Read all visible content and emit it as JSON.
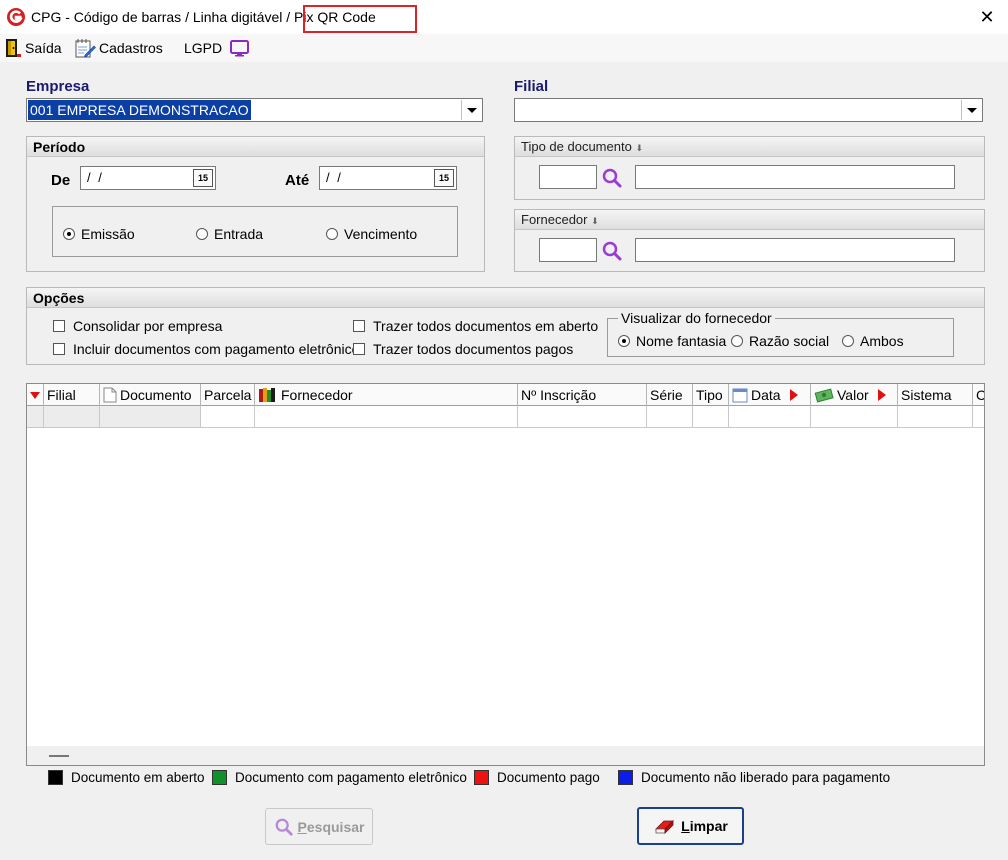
{
  "window": {
    "title_prefix": "CPG - Código de barras / Linha digitável /",
    "title_highlight": "Pix QR Code",
    "close_label": "✕"
  },
  "menu": {
    "items": [
      {
        "label": "Saída",
        "icon": "exit-door-icon"
      },
      {
        "label": "Cadastros",
        "icon": "notepad-icon"
      },
      {
        "label": "LGPD",
        "icon": "monitor-icon"
      }
    ]
  },
  "empresa": {
    "label": "Empresa",
    "value": "001 EMPRESA DEMONSTRACAO"
  },
  "filial": {
    "label": "Filial",
    "value": ""
  },
  "periodo": {
    "title": "Período",
    "de_label": "De",
    "de_value": "/ /",
    "ate_label": "Até",
    "ate_value": "/ /",
    "calendar_label": "15",
    "options": [
      {
        "label": "Emissão",
        "selected": true
      },
      {
        "label": "Entrada",
        "selected": false
      },
      {
        "label": "Vencimento",
        "selected": false
      }
    ]
  },
  "tipo_documento": {
    "label": "Tipo de documento",
    "code": "",
    "desc": ""
  },
  "fornecedor": {
    "label": "Fornecedor",
    "code": "",
    "desc": ""
  },
  "opcoes": {
    "title": "Opções",
    "checks": [
      {
        "label": "Consolidar por empresa",
        "checked": false
      },
      {
        "label": "Incluir documentos com pagamento eletrônico",
        "checked": false
      },
      {
        "label": "Trazer todos documentos em aberto",
        "checked": false
      },
      {
        "label": "Trazer todos documentos pagos",
        "checked": false
      }
    ],
    "visualizar": {
      "title": "Visualizar do fornecedor",
      "options": [
        {
          "label": "Nome fantasia",
          "selected": true
        },
        {
          "label": "Razão social",
          "selected": false
        },
        {
          "label": "Ambos",
          "selected": false
        }
      ]
    }
  },
  "grid": {
    "columns": [
      "Filial",
      "Documento",
      "Parcela",
      "Fornecedor",
      "Nº Inscrição",
      "Série",
      "Tipo",
      "Data",
      "Valor",
      "Sistema",
      "C"
    ]
  },
  "legend": [
    {
      "label": "Documento em aberto",
      "color": "#000000"
    },
    {
      "label": "Documento com pagamento eletrônico",
      "color": "#11912a"
    },
    {
      "label": "Documento pago",
      "color": "#ee1111"
    },
    {
      "label": "Documento não liberado para pagamento",
      "color": "#0a1ee8"
    }
  ],
  "buttons": {
    "pesquisar": {
      "mnemonic": "P",
      "rest": "esquisar"
    },
    "limpar": {
      "mnemonic": "L",
      "rest": "impar"
    }
  }
}
